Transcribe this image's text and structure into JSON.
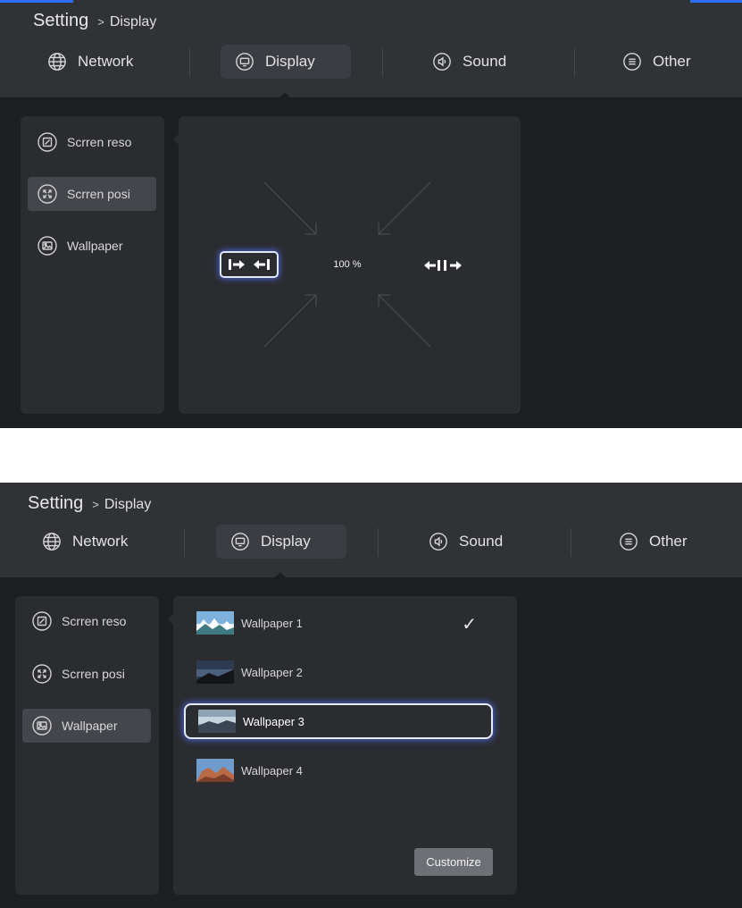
{
  "colors": {
    "accent": "#2e6df5",
    "focus_glow": "#4a63d8"
  },
  "screens": [
    {
      "breadcrumb": {
        "root": "Setting",
        "separator": ">",
        "current": "Display"
      },
      "tabs": [
        {
          "label": "Network",
          "icon": "globe-icon"
        },
        {
          "label": "Display",
          "icon": "display-icon",
          "active": true
        },
        {
          "label": "Sound",
          "icon": "speaker-icon"
        },
        {
          "label": "Other",
          "icon": "menu-icon"
        }
      ],
      "sidebar": [
        {
          "label": "Scrren reso",
          "icon": "resolution-icon"
        },
        {
          "label": "Scrren posi",
          "icon": "position-icon",
          "active": true
        },
        {
          "label": "Wallpaper",
          "icon": "wallpaper-icon"
        }
      ],
      "position": {
        "zoom": "100 %",
        "shrink_icon": "shrink-arrows-icon",
        "expand_icon": "expand-arrows-icon"
      }
    },
    {
      "breadcrumb": {
        "root": "Setting",
        "separator": ">",
        "current": "Display"
      },
      "tabs": [
        {
          "label": "Network",
          "icon": "globe-icon"
        },
        {
          "label": "Display",
          "icon": "display-icon",
          "active": true
        },
        {
          "label": "Sound",
          "icon": "speaker-icon"
        },
        {
          "label": "Other",
          "icon": "menu-icon"
        }
      ],
      "sidebar": [
        {
          "label": "Scrren reso",
          "icon": "resolution-icon"
        },
        {
          "label": "Scrren posi",
          "icon": "position-icon"
        },
        {
          "label": "Wallpaper",
          "icon": "wallpaper-icon",
          "active": true
        }
      ],
      "wallpapers": [
        {
          "label": "Wallpaper 1",
          "selected": true,
          "check": "✓"
        },
        {
          "label": "Wallpaper 2"
        },
        {
          "label": "Wallpaper 3",
          "focused": true
        },
        {
          "label": "Wallpaper 4"
        }
      ],
      "customize_label": "Customize"
    }
  ]
}
